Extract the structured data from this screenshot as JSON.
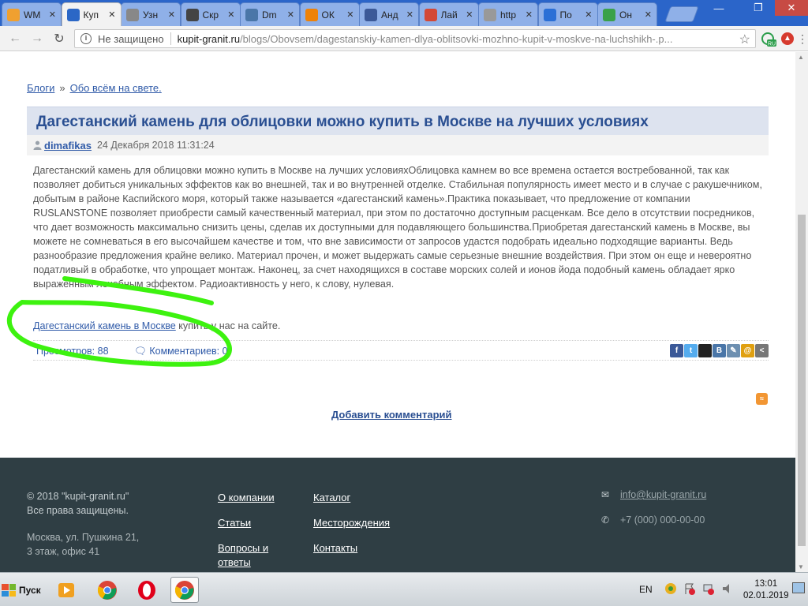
{
  "browser": {
    "tabs": [
      {
        "label": "WM",
        "icon": "orange-circle-icon",
        "color": "#f0a030"
      },
      {
        "label": "Куп",
        "icon": "g-logo-icon",
        "color": "#2b67c6",
        "active": true
      },
      {
        "label": "Узн",
        "icon": "search-icon",
        "color": "#888888"
      },
      {
        "label": "Скр",
        "icon": "p-logo-icon",
        "color": "#444444"
      },
      {
        "label": "Dm",
        "icon": "vk-icon",
        "color": "#4a76a8"
      },
      {
        "label": "ОК",
        "icon": "ok-icon",
        "color": "#ee8208"
      },
      {
        "label": "Анд",
        "icon": "facebook-icon",
        "color": "#3b5998"
      },
      {
        "label": "Лай",
        "icon": "google-plus-icon",
        "color": "#d34836"
      },
      {
        "label": "http",
        "icon": "page-icon",
        "color": "#999999"
      },
      {
        "label": "По",
        "icon": "mail-at-icon",
        "color": "#2a6fd6"
      },
      {
        "label": "Он",
        "icon": "green-circle-icon",
        "color": "#3aa14a"
      }
    ],
    "address": {
      "security": "Не защищено",
      "host": "kupit-granit.ru",
      "path": "/blogs/Obovsem/dagestanskiy-kamen-dlya-oblitsovki-mozhno-kupit-v-moskve-na-luchshikh-.p..."
    },
    "ext_badge": "RU"
  },
  "page": {
    "breadcrumbs": [
      {
        "label": "Блоги"
      },
      {
        "label": "Обо всём на свете."
      }
    ],
    "breadcrumb_sep": "»",
    "title": "Дагестанский камень для облицовки можно купить в Москве на лучших условиях",
    "author": "dimafikas",
    "date": "24 Декабря 2018 11:31:24",
    "body": "Дагестанский камень для облицовки можно купить в Москве на лучших условияхОблицовка камнем во все времена остается востребованной, так как позволяет добиться уникальных эффектов как во внешней, так и во внутренней отделке. Стабильная популярность имеет место и в случае с ракушечником, добытым в районе Каспийского моря, который также называется «дагестанский камень».Практика показывает, что предложение от компании RUSLANSTONE позволяет приобрести самый качественный материал, при этом по достаточно доступным расценкам. Все дело в отсутствии посредников, что дает возможность максимально снизить цены, сделав их доступными для подавляющего большинства.Приобретая дагестанский камень в Москве, вы можете не сомневаться в его высочайшем качестве и том, что вне зависимости от запросов удастся подобрать идеально подходящие варианты. Ведь разнообразие предложения крайне велико. Материал прочен, и может выдержать самые серьезные внешние воздействия. При этом он еще и невероятно податливый в обработке, что упрощает монтаж. Наконец, за счет находящихся в составе морских солей и ионов йода подобный камень обладает ярко выраженным лечебным эффектом. Радиоактивность у него, к слову, нулевая.",
    "buy_link": "Дагестанский камень в Москве",
    "buy_rest": " купить у нас на сайте.",
    "views": "Просмотров: 88",
    "comments": "Комментариев: 0",
    "add_comment": "Добавить комментарий",
    "share_icons": [
      {
        "name": "facebook-share-icon",
        "glyph": "f",
        "color": "#3b5998"
      },
      {
        "name": "twitter-share-icon",
        "glyph": "t",
        "color": "#55acee"
      },
      {
        "name": "delicious-share-icon",
        "glyph": "",
        "color": "#222222"
      },
      {
        "name": "vk-share-icon",
        "glyph": "B",
        "color": "#4a76a8"
      },
      {
        "name": "livejournal-share-icon",
        "glyph": "✎",
        "color": "#6d8fb0"
      },
      {
        "name": "mailru-share-icon",
        "glyph": "@",
        "color": "#e0a010"
      },
      {
        "name": "more-share-icon",
        "glyph": "<",
        "color": "#777777"
      }
    ]
  },
  "footer": {
    "copyright": "© 2018 \"kupit-granit.ru\"",
    "rights": "Все права защищены.",
    "address1": "Москва, ул. Пушкина 21,",
    "address2": "3 этаж, офис 41",
    "links_col1": [
      "О компании",
      "Статьи",
      "Вопросы и",
      "ответы"
    ],
    "links_col2": [
      "Каталог",
      "Месторождения",
      "Контакты"
    ],
    "email": "info@kupit-granit.ru",
    "phone": "+7 (000) 000-00-00"
  },
  "taskbar": {
    "start": "Пуск",
    "lang": "EN",
    "time": "13:01",
    "date": "02.01.2019"
  },
  "colors": {
    "link": "#2f5aa8",
    "title": "#2a4f92",
    "footer_bg": "#2f3e44",
    "marker": "#3df20f"
  }
}
